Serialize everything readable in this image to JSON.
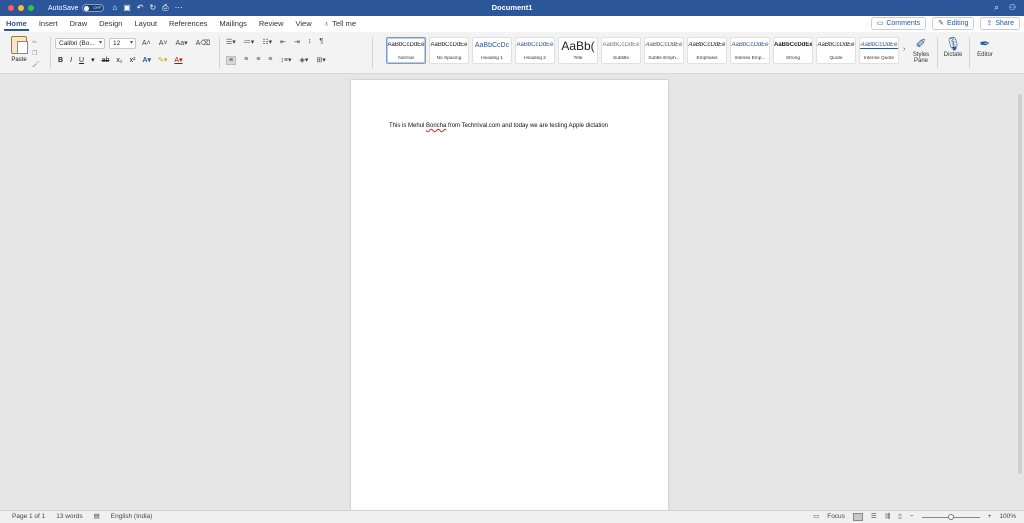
{
  "titlebar": {
    "autosave_label": "AutoSave",
    "autosave_state": "OFF",
    "document_title": "Document1",
    "icons": [
      "home-icon",
      "save-icon",
      "undo-icon",
      "redo-icon",
      "print-icon",
      "more-icon"
    ]
  },
  "tabs": [
    {
      "label": "Home"
    },
    {
      "label": "Insert"
    },
    {
      "label": "Draw"
    },
    {
      "label": "Design"
    },
    {
      "label": "Layout"
    },
    {
      "label": "References"
    },
    {
      "label": "Mailings"
    },
    {
      "label": "Review"
    },
    {
      "label": "View"
    }
  ],
  "tellme": "Tell me",
  "actions": {
    "comments": "Comments",
    "editing": "Editing",
    "share": "Share"
  },
  "ribbon": {
    "paste_label": "Paste",
    "font_name": "Calibri (Bo...",
    "font_size": "12",
    "styles": [
      {
        "sample": "AaBbCcDdEe",
        "name": "Normal"
      },
      {
        "sample": "AaBbCcDdEe",
        "name": "No Spacing"
      },
      {
        "sample": "AaBbCcDc",
        "name": "Heading 1"
      },
      {
        "sample": "AaBbCcDdEe",
        "name": "Heading 2"
      },
      {
        "sample": "AaBb(",
        "name": "Title"
      },
      {
        "sample": "AaBbCcDdEe",
        "name": "Subtitle"
      },
      {
        "sample": "AaBbCcDdEe",
        "name": "Subtle Emph..."
      },
      {
        "sample": "AaBbCcDdEe",
        "name": "Emphasis"
      },
      {
        "sample": "AaBbCcDdEe",
        "name": "Intense Emp..."
      },
      {
        "sample": "AaBbCcDdEe",
        "name": "Strong"
      },
      {
        "sample": "AaBbCcDdEe",
        "name": "Quote"
      },
      {
        "sample": "AaBbCcDdEe",
        "name": "Intense Quote"
      }
    ],
    "styles_pane_label": "Styles Pane",
    "dictate_label": "Dictate",
    "editor_label": "Editor"
  },
  "document": {
    "text_before": "This is Mehul ",
    "misspelled": "Boricha",
    "text_after": " from Techrrival.com and today we are testing Apple dictation"
  },
  "statusbar": {
    "page": "Page 1 of 1",
    "words": "13 words",
    "language": "English (India)",
    "focus": "Focus",
    "zoom": "100%"
  },
  "colors": {
    "brand": "#2b579a",
    "canvas": "#e6e6e6",
    "ribbon": "#f3f3f3"
  }
}
